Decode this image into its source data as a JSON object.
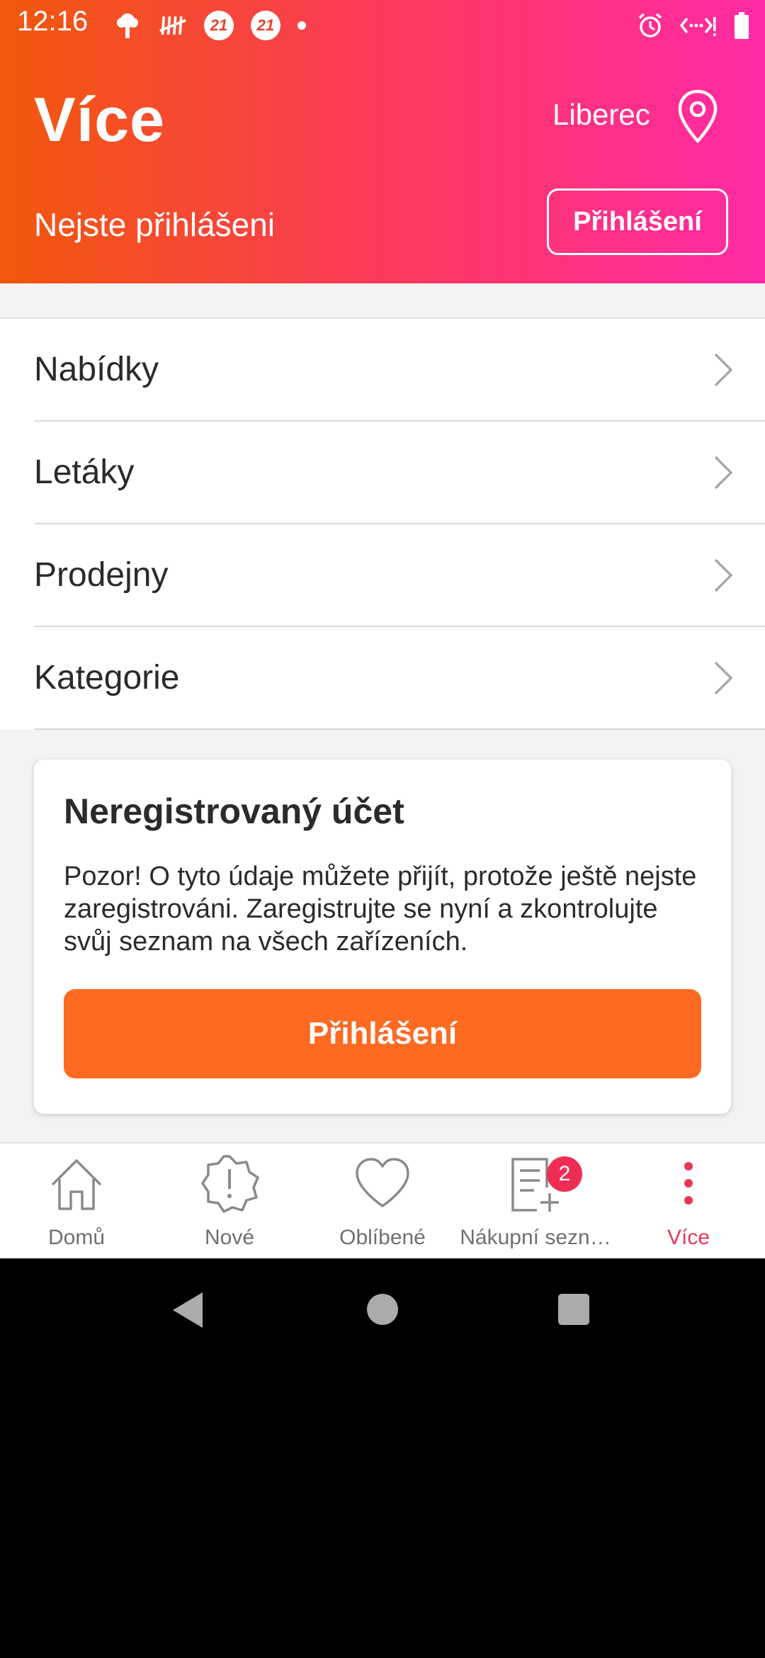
{
  "status_bar": {
    "time": "12:16",
    "notification_badges": [
      "21",
      "21"
    ]
  },
  "header": {
    "title": "Více",
    "location": "Liberec",
    "login_status": "Nejste přihlášeni",
    "login_button": "Přihlášení"
  },
  "menu": {
    "items": [
      {
        "label": "Nabídky"
      },
      {
        "label": "Letáky"
      },
      {
        "label": "Prodejny"
      },
      {
        "label": "Kategorie"
      }
    ]
  },
  "card": {
    "title": "Neregistrovaný účet",
    "text": "Pozor! O tyto údaje můžete přijít, protože ještě nejste zaregistrováni. Zaregistrujte se nyní a zkontrolujte svůj seznam na všech zařízeních.",
    "button": "Přihlášení"
  },
  "bottom_nav": {
    "items": [
      {
        "label": "Domů",
        "icon": "home-icon"
      },
      {
        "label": "Nové",
        "icon": "new-badge-icon"
      },
      {
        "label": "Oblíbené",
        "icon": "heart-icon"
      },
      {
        "label": "Nákupní sezn…",
        "icon": "shopping-list-icon",
        "badge": "2"
      },
      {
        "label": "Více",
        "icon": "more-icon",
        "active": true
      }
    ]
  },
  "colors": {
    "header_gradient_start": "#f2580c",
    "header_gradient_end": "#ff2aa6",
    "accent_orange": "#fd6a22",
    "active_pink": "#e8365a"
  }
}
